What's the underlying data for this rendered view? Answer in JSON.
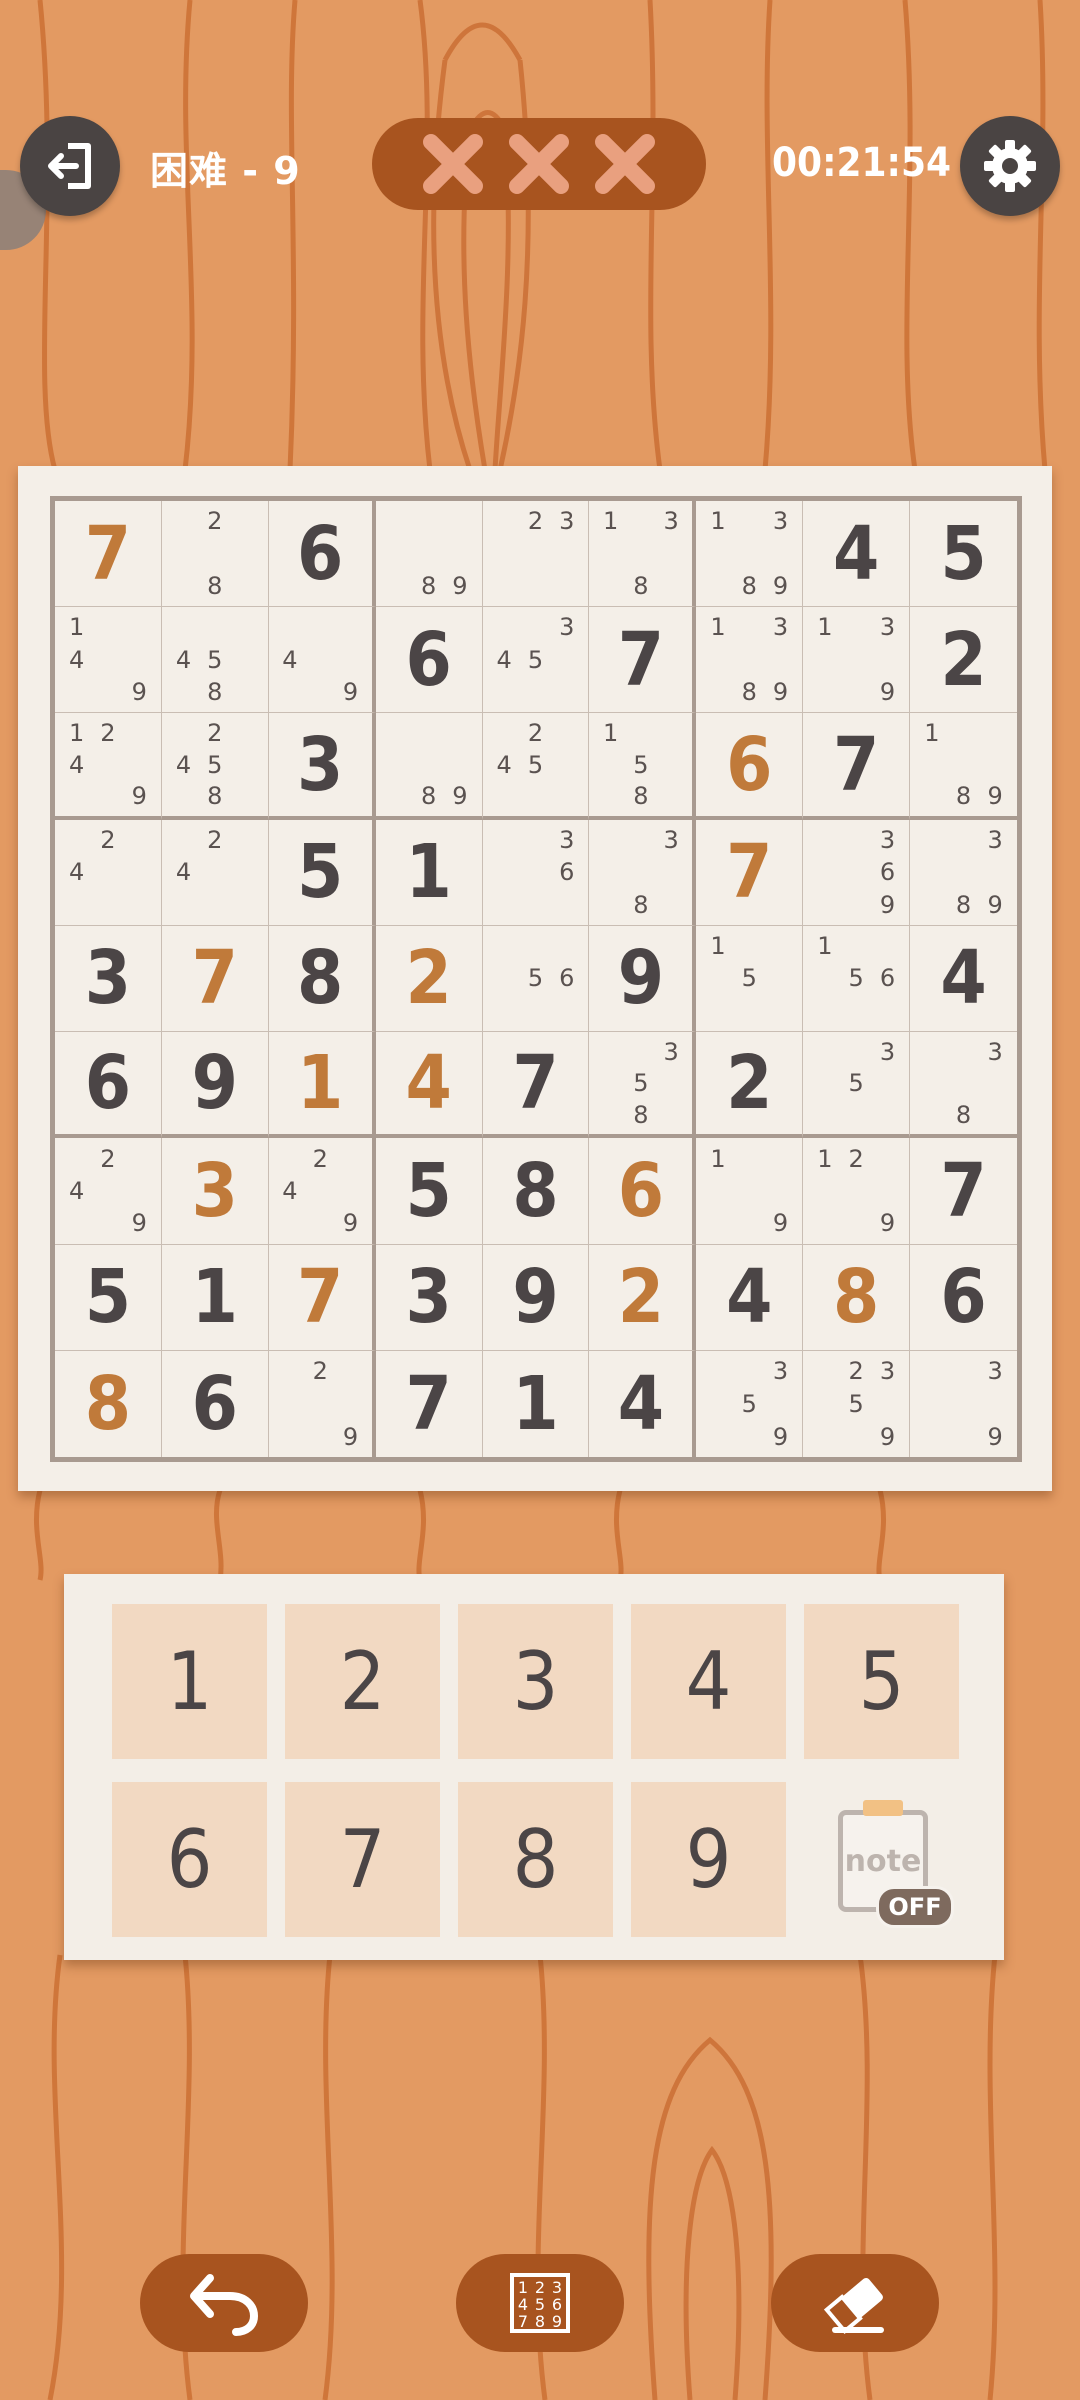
{
  "header": {
    "level": "困难 - 9",
    "timer": "00:21:54",
    "mistakes": [
      "×",
      "×",
      "×"
    ]
  },
  "icons": {
    "exit": "exit-icon",
    "settings": "gear-icon",
    "undo": "undo-icon",
    "candidates": "candidates-grid-icon",
    "erase": "eraser-icon"
  },
  "colors": {
    "background": "#e39a62",
    "given_digit": "#4b4546",
    "user_digit": "#c07a3a",
    "accent": "#a8541f"
  },
  "board": {
    "cells": [
      [
        {
          "v": "7",
          "t": "user"
        },
        {
          "n": [
            2,
            8
          ]
        },
        {
          "v": "6",
          "t": "given"
        },
        {
          "n": [
            8,
            9
          ]
        },
        {
          "n": [
            2,
            3
          ]
        },
        {
          "n": [
            1,
            3,
            8
          ]
        },
        {
          "n": [
            1,
            3,
            8,
            9
          ]
        },
        {
          "v": "4",
          "t": "given"
        },
        {
          "v": "5",
          "t": "given"
        }
      ],
      [
        {
          "n": [
            1,
            4,
            9
          ]
        },
        {
          "n": [
            4,
            5,
            8
          ]
        },
        {
          "n": [
            4,
            9
          ]
        },
        {
          "v": "6",
          "t": "given"
        },
        {
          "n": [
            3,
            4,
            5
          ]
        },
        {
          "v": "7",
          "t": "given"
        },
        {
          "n": [
            1,
            3,
            8,
            9
          ]
        },
        {
          "n": [
            1,
            3,
            9
          ]
        },
        {
          "v": "2",
          "t": "given"
        }
      ],
      [
        {
          "n": [
            1,
            2,
            4,
            9
          ]
        },
        {
          "n": [
            2,
            4,
            5,
            8
          ]
        },
        {
          "v": "3",
          "t": "given"
        },
        {
          "n": [
            8,
            9
          ]
        },
        {
          "n": [
            2,
            4,
            5
          ]
        },
        {
          "n": [
            1,
            5,
            8
          ]
        },
        {
          "v": "6",
          "t": "user"
        },
        {
          "v": "7",
          "t": "given"
        },
        {
          "n": [
            1,
            8,
            9
          ]
        }
      ],
      [
        {
          "n": [
            2,
            4
          ]
        },
        {
          "n": [
            2,
            4
          ]
        },
        {
          "v": "5",
          "t": "given"
        },
        {
          "v": "1",
          "t": "given"
        },
        {
          "n": [
            3,
            6
          ]
        },
        {
          "n": [
            3,
            8
          ]
        },
        {
          "v": "7",
          "t": "user"
        },
        {
          "n": [
            3,
            6,
            9
          ]
        },
        {
          "n": [
            3,
            8,
            9
          ]
        }
      ],
      [
        {
          "v": "3",
          "t": "given"
        },
        {
          "v": "7",
          "t": "user"
        },
        {
          "v": "8",
          "t": "given"
        },
        {
          "v": "2",
          "t": "user"
        },
        {
          "n": [
            5,
            6
          ]
        },
        {
          "v": "9",
          "t": "given"
        },
        {
          "n": [
            1,
            5
          ]
        },
        {
          "n": [
            1,
            5,
            6
          ]
        },
        {
          "v": "4",
          "t": "given"
        }
      ],
      [
        {
          "v": "6",
          "t": "given"
        },
        {
          "v": "9",
          "t": "given"
        },
        {
          "v": "1",
          "t": "user"
        },
        {
          "v": "4",
          "t": "user"
        },
        {
          "v": "7",
          "t": "given"
        },
        {
          "n": [
            3,
            5,
            8
          ]
        },
        {
          "v": "2",
          "t": "given"
        },
        {
          "n": [
            3,
            5
          ]
        },
        {
          "n": [
            3,
            8
          ]
        }
      ],
      [
        {
          "n": [
            2,
            4,
            9
          ]
        },
        {
          "v": "3",
          "t": "user"
        },
        {
          "n": [
            2,
            4,
            9
          ]
        },
        {
          "v": "5",
          "t": "given"
        },
        {
          "v": "8",
          "t": "given"
        },
        {
          "v": "6",
          "t": "user"
        },
        {
          "n": [
            1,
            9
          ]
        },
        {
          "n": [
            1,
            2,
            9
          ]
        },
        {
          "v": "7",
          "t": "given"
        }
      ],
      [
        {
          "v": "5",
          "t": "given"
        },
        {
          "v": "1",
          "t": "given"
        },
        {
          "v": "7",
          "t": "user"
        },
        {
          "v": "3",
          "t": "given"
        },
        {
          "v": "9",
          "t": "given"
        },
        {
          "v": "2",
          "t": "user"
        },
        {
          "v": "4",
          "t": "given"
        },
        {
          "v": "8",
          "t": "user"
        },
        {
          "v": "6",
          "t": "given"
        }
      ],
      [
        {
          "v": "8",
          "t": "user"
        },
        {
          "v": "6",
          "t": "given"
        },
        {
          "n": [
            2,
            9
          ]
        },
        {
          "v": "7",
          "t": "given"
        },
        {
          "v": "1",
          "t": "given"
        },
        {
          "v": "4",
          "t": "given"
        },
        {
          "n": [
            3,
            5,
            9
          ]
        },
        {
          "n": [
            2,
            3,
            5,
            9
          ]
        },
        {
          "n": [
            3,
            9
          ]
        }
      ]
    ]
  },
  "pad": {
    "keys": [
      "1",
      "2",
      "3",
      "4",
      "5",
      "6",
      "7",
      "8",
      "9"
    ],
    "note_label": "note",
    "note_state": "OFF"
  },
  "candidates_icon_text": "123456789"
}
